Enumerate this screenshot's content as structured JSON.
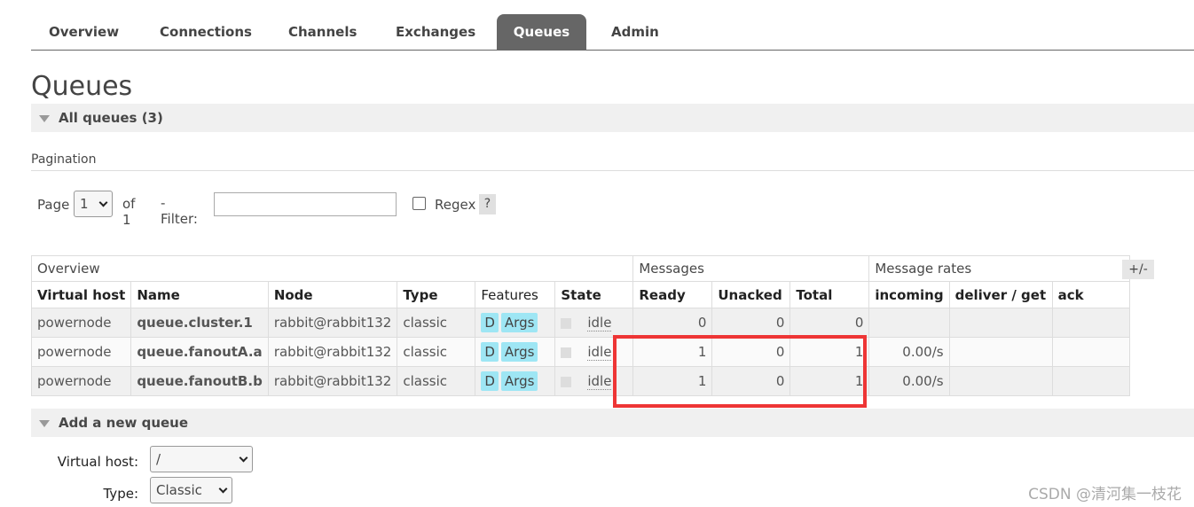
{
  "nav": {
    "tabs": [
      {
        "label": "Overview"
      },
      {
        "label": "Connections"
      },
      {
        "label": "Channels"
      },
      {
        "label": "Exchanges"
      },
      {
        "label": "Queues",
        "active": true
      },
      {
        "label": "Admin"
      }
    ]
  },
  "page_title": "Queues",
  "all_queues_header": "All queues (3)",
  "pagination": {
    "label": "Pagination",
    "page_label": "Page",
    "page_value": "1",
    "of_label": "of 1",
    "filter_label": "- Filter:",
    "filter_value": "",
    "regex_label": "Regex",
    "help_label": "?"
  },
  "table": {
    "groups": {
      "overview": "Overview",
      "messages": "Messages",
      "rates": "Message rates"
    },
    "columns": {
      "vhost": "Virtual host",
      "name": "Name",
      "node": "Node",
      "type": "Type",
      "features": "Features",
      "state": "State",
      "ready": "Ready",
      "unacked": "Unacked",
      "total": "Total",
      "incoming": "incoming",
      "deliver": "deliver / get",
      "ack": "ack"
    },
    "toggle_label": "+/-",
    "rows": [
      {
        "vhost": "powernode",
        "name": "queue.cluster.1",
        "node": "rabbit@rabbit132",
        "type": "classic",
        "feature_d": "D",
        "feature_args": "Args",
        "state": "idle",
        "ready": "0",
        "unacked": "0",
        "total": "0",
        "incoming": "",
        "deliver": "",
        "ack": ""
      },
      {
        "vhost": "powernode",
        "name": "queue.fanoutA.a",
        "node": "rabbit@rabbit132",
        "type": "classic",
        "feature_d": "D",
        "feature_args": "Args",
        "state": "idle",
        "ready": "1",
        "unacked": "0",
        "total": "1",
        "incoming": "0.00/s",
        "deliver": "",
        "ack": ""
      },
      {
        "vhost": "powernode",
        "name": "queue.fanoutB.b",
        "node": "rabbit@rabbit132",
        "type": "classic",
        "feature_d": "D",
        "feature_args": "Args",
        "state": "idle",
        "ready": "1",
        "unacked": "0",
        "total": "1",
        "incoming": "0.00/s",
        "deliver": "",
        "ack": ""
      }
    ]
  },
  "add_queue": {
    "header": "Add a new queue",
    "vhost_label": "Virtual host:",
    "vhost_value": "/",
    "type_label": "Type:",
    "type_value": "Classic"
  },
  "watermark": "CSDN @清河集一枝花",
  "colors": {
    "highlight": "#ee3535",
    "feature_badge": "#9ee6f4",
    "active_tab": "#666666"
  }
}
